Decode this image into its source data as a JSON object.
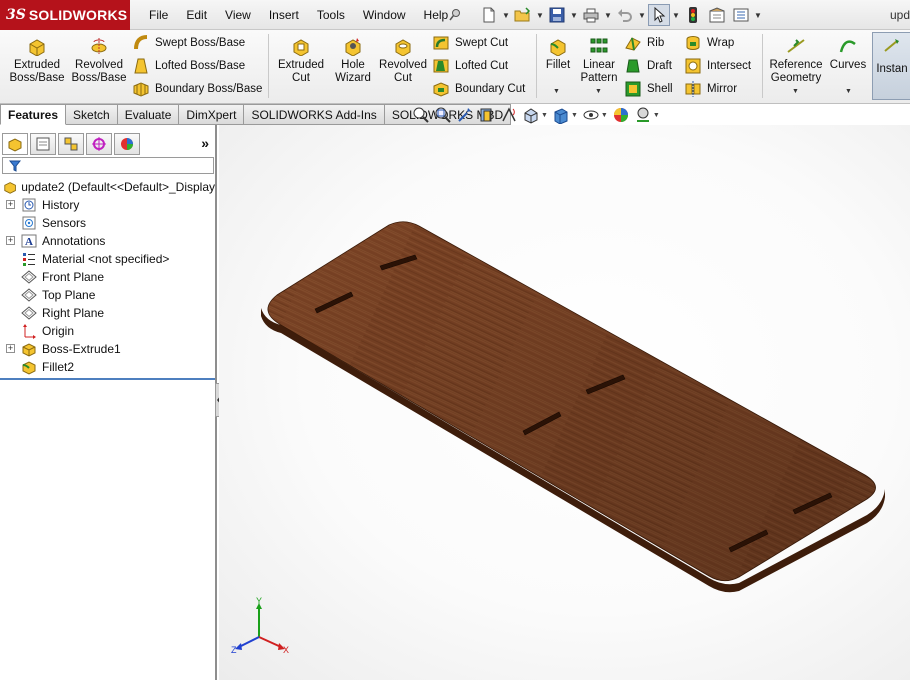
{
  "app": {
    "brand_prefix": "3S",
    "brand_name": "SOLIDWORKS",
    "document_title": "upd"
  },
  "menu": {
    "items": [
      "File",
      "Edit",
      "View",
      "Insert",
      "Tools",
      "Window",
      "Help"
    ]
  },
  "quick_access": {
    "icons": [
      "pin-icon",
      "new-document-icon",
      "open-icon",
      "save-icon",
      "print-icon",
      "undo-icon",
      "select-icon",
      "rebuild-icon",
      "file-properties-icon",
      "options-icon"
    ]
  },
  "command_manager": {
    "extruded_boss": "Extruded Boss/Base",
    "revolved_boss": "Revolved Boss/Base",
    "swept_boss": "Swept Boss/Base",
    "lofted_boss": "Lofted Boss/Base",
    "boundary_boss": "Boundary Boss/Base",
    "extruded_cut": "Extruded Cut",
    "hole_wizard": "Hole Wizard",
    "revolved_cut": "Revolved Cut",
    "swept_cut": "Swept Cut",
    "lofted_cut": "Lofted Cut",
    "boundary_cut": "Boundary Cut",
    "fillet": "Fillet",
    "linear_pattern": "Linear Pattern",
    "rib": "Rib",
    "draft": "Draft",
    "shell": "Shell",
    "wrap": "Wrap",
    "intersect": "Intersect",
    "mirror": "Mirror",
    "reference_geometry": "Reference Geometry",
    "curves": "Curves",
    "instant3d": "Instan"
  },
  "tabs": {
    "items": [
      "Features",
      "Sketch",
      "Evaluate",
      "DimXpert",
      "SOLIDWORKS Add-Ins",
      "SOLIDWORKS MBD"
    ],
    "active": "Features"
  },
  "feature_tree": {
    "root": "update2  (Default<<Default>_Display",
    "items": [
      {
        "label": "History",
        "icon": "history-icon",
        "expandable": true
      },
      {
        "label": "Sensors",
        "icon": "sensors-icon",
        "expandable": false
      },
      {
        "label": "Annotations",
        "icon": "annotations-icon",
        "expandable": true
      },
      {
        "label": "Material <not specified>",
        "icon": "material-icon",
        "expandable": false
      },
      {
        "label": "Front Plane",
        "icon": "plane-icon",
        "expandable": false
      },
      {
        "label": "Top Plane",
        "icon": "plane-icon",
        "expandable": false
      },
      {
        "label": "Right Plane",
        "icon": "plane-icon",
        "expandable": false
      },
      {
        "label": "Origin",
        "icon": "origin-icon",
        "expandable": false
      },
      {
        "label": "Boss-Extrude1",
        "icon": "boss-extrude-icon",
        "expandable": true
      },
      {
        "label": "Fillet2",
        "icon": "fillet-icon",
        "expandable": false
      }
    ]
  },
  "panel_tabs": [
    "feature-manager-icon",
    "property-manager-icon",
    "configuration-manager-icon",
    "dimxpert-manager-icon",
    "display-manager-icon"
  ],
  "heads_up_toolbar": [
    "zoom-to-fit-icon",
    "zoom-to-area-icon",
    "previous-view-icon",
    "section-view-icon",
    "dynamic-annotation-icon",
    "view-orientation-icon",
    "display-style-icon",
    "hide-show-items-icon",
    "edit-appearance-icon",
    "apply-scene-icon"
  ],
  "triad": {
    "x": "X",
    "y": "Y",
    "z": "Z"
  },
  "colors": {
    "brand_red": "#b5121b",
    "wood_light": "#8a4e2a",
    "wood_dark": "#4a2410",
    "accent_blue": "#4d7fbf"
  }
}
